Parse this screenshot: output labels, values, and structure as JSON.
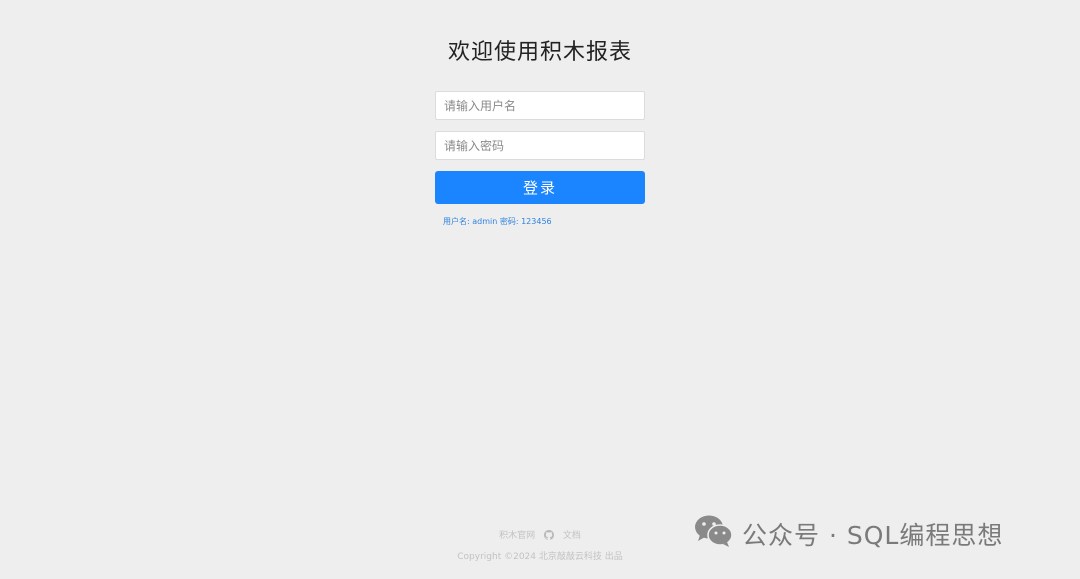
{
  "login": {
    "title": "欢迎使用积木报表",
    "username_placeholder": "请输入用户名",
    "password_placeholder": "请输入密码",
    "submit_label": "登录",
    "hint": "用户名: admin 密码: 123456"
  },
  "footer": {
    "link_official": "积木官网",
    "link_docs": "文档",
    "copyright": "Copyright ©2024 北京敲敲云科技 出品"
  },
  "watermark": {
    "text": "公众号 · SQL编程思想",
    "icon": "wechat-icon"
  },
  "colors": {
    "background": "#eeeeee",
    "primary": "#1a85ff",
    "hint": "#2f82e0",
    "footer_text": "#c2c2c2"
  }
}
